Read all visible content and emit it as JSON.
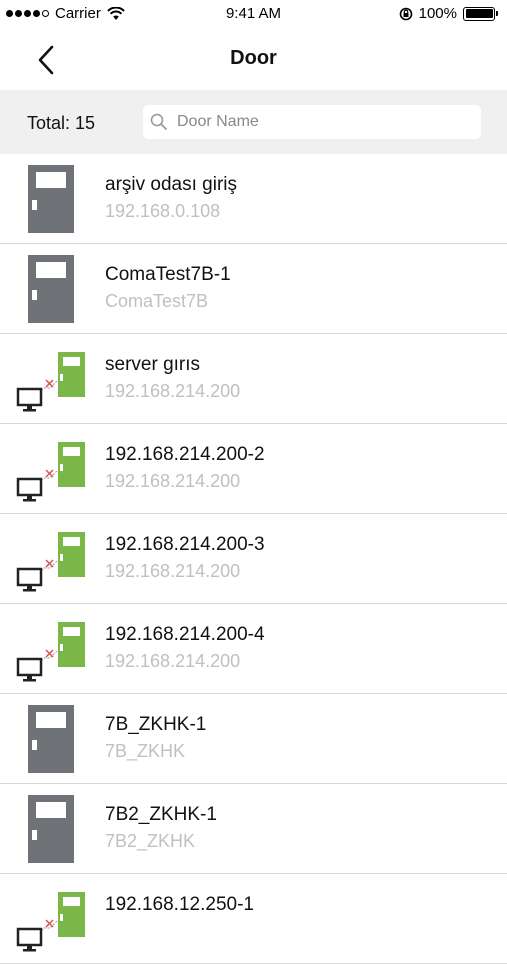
{
  "status_bar": {
    "carrier": "Carrier",
    "time": "9:41 AM",
    "battery_percent": "100%",
    "signal_strength": 4,
    "signal_max": 5
  },
  "nav": {
    "title": "Door",
    "back_icon": "chevron-left-icon"
  },
  "filter": {
    "total_label": "Total: 15",
    "search_placeholder": "Door Name",
    "search_value": ""
  },
  "colors": {
    "offline_door": "#6f7377",
    "online_door": "#7ab648",
    "disconnect_mark": "#d9534f",
    "subtitle": "#c0c0c0"
  },
  "doors": [
    {
      "name": "arşiv odası giriş",
      "subtitle": "192.168.0.108",
      "icon": "door-icon"
    },
    {
      "name": "ComaTest7B-1",
      "subtitle": "ComaTest7B",
      "icon": "door-icon"
    },
    {
      "name": "server gırıs",
      "subtitle": "192.168.214.200",
      "icon": "door-disconnected-icon"
    },
    {
      "name": "192.168.214.200-2",
      "subtitle": "192.168.214.200",
      "icon": "door-disconnected-icon"
    },
    {
      "name": "192.168.214.200-3",
      "subtitle": "192.168.214.200",
      "icon": "door-disconnected-icon"
    },
    {
      "name": "192.168.214.200-4",
      "subtitle": "192.168.214.200",
      "icon": "door-disconnected-icon"
    },
    {
      "name": "7B_ZKHK-1",
      "subtitle": "7B_ZKHK",
      "icon": "door-icon"
    },
    {
      "name": "7B2_ZKHK-1",
      "subtitle": "7B2_ZKHK",
      "icon": "door-icon"
    },
    {
      "name": "192.168.12.250-1",
      "subtitle": "",
      "icon": "door-disconnected-icon"
    }
  ]
}
